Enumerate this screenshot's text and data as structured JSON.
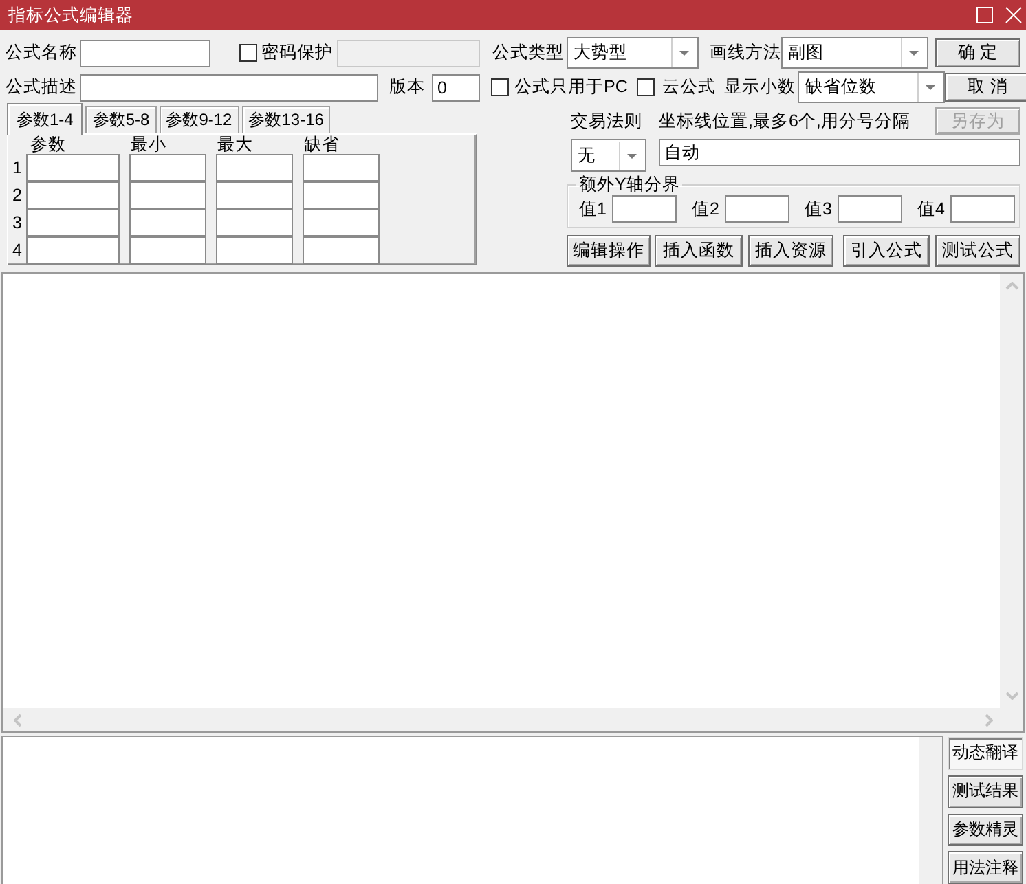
{
  "window": {
    "title": "指标公式编辑器"
  },
  "header": {
    "name": {
      "label": "公式名称"
    },
    "password": {
      "label": "密码保护",
      "checked": false
    },
    "formula_type": {
      "label": "公式类型",
      "value": "大势型"
    },
    "draw_method": {
      "label": "画线方法",
      "value": "副图"
    },
    "description": {
      "label": "公式描述"
    },
    "version": {
      "label": "版本",
      "value": "0"
    },
    "pc_only": {
      "label": "公式只用于PC",
      "checked": false
    },
    "cloud_formula": {
      "label": "云公式",
      "checked": false
    },
    "decimals": {
      "label": "显示小数",
      "value": "缺省位数"
    }
  },
  "buttons": [
    {
      "label": "确 定",
      "disabled": false
    },
    {
      "label": "取 消",
      "disabled": false
    },
    {
      "label": "另存为",
      "disabled": true
    }
  ],
  "param_tabs": [
    {
      "label": "参数1-4",
      "selected": true
    },
    {
      "label": "参数5-8",
      "selected": false
    },
    {
      "label": "参数9-12",
      "selected": false
    },
    {
      "label": "参数13-16",
      "selected": false
    }
  ],
  "param_table": {
    "columns": [
      "参数",
      "最小",
      "最大",
      "缺省"
    ],
    "rows": [
      "1",
      "2",
      "3",
      "4"
    ]
  },
  "trade_rule": {
    "label": "交易法则",
    "value": "无"
  },
  "axis_lines": {
    "label": "坐标线位置,最多6个,用分号分隔",
    "value": "自动"
  },
  "y_axis_bounds": {
    "legend": "额外Y轴分界",
    "fields": [
      "值1",
      "值2",
      "值3",
      "值4"
    ]
  },
  "tool_buttons": [
    "编辑操作",
    "插入函数",
    "插入资源",
    "引入公式",
    "测试公式"
  ],
  "side_tabs": [
    {
      "label": "动态翻译",
      "selected": true
    },
    {
      "label": "测试结果",
      "selected": false
    },
    {
      "label": "参数精灵",
      "selected": false
    },
    {
      "label": "用法注释",
      "selected": false
    }
  ]
}
